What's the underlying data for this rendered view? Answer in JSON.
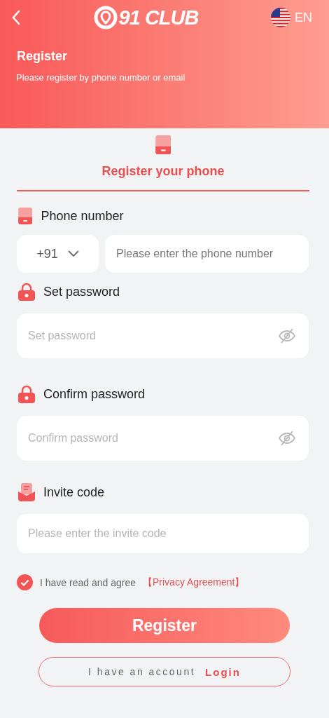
{
  "header": {
    "logo_text": "91 CLUB",
    "language": "EN",
    "title": "Register",
    "subtitle": "Please register by phone number or email"
  },
  "tabs": [
    {
      "label": "Register your phone",
      "selected": true
    }
  ],
  "fields": [
    {
      "kind": "phone",
      "label": "Phone number",
      "country_code": "+91",
      "placeholder": "Please enter the phone number"
    },
    {
      "kind": "password",
      "label": "Set password",
      "placeholder": "Set password"
    },
    {
      "kind": "password",
      "label": "Confirm password",
      "placeholder": "Confirm password"
    },
    {
      "kind": "invite",
      "label": "Invite code",
      "placeholder": "Please enter the invite code"
    }
  ],
  "agreement": {
    "checked": true,
    "text": "I have read and agree",
    "link": "【Privacy Agreement】"
  },
  "register_button": "Register",
  "login": {
    "text": "I have an account",
    "link": "Login"
  }
}
